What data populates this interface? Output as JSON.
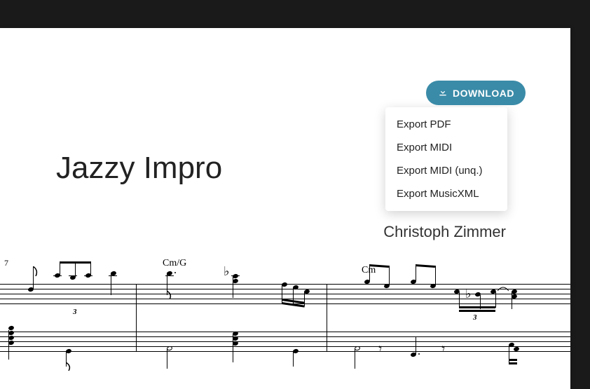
{
  "header": {
    "download_label": "DOWNLOAD",
    "menu": {
      "export_pdf": "Export PDF",
      "export_midi": "Export MIDI",
      "export_midi_unq": "Export MIDI (unq.)",
      "export_musicxml": "Export MusicXML"
    }
  },
  "score": {
    "title": "Jazzy Impro",
    "composer": "Christoph Zimmer",
    "chords": {
      "left": "7",
      "mid": "Cm/G",
      "right": "Cm"
    },
    "tuplets": {
      "three": "3"
    },
    "accidentals": {
      "flat": "♭"
    },
    "rests": {
      "eighth": "𝄾"
    }
  }
}
